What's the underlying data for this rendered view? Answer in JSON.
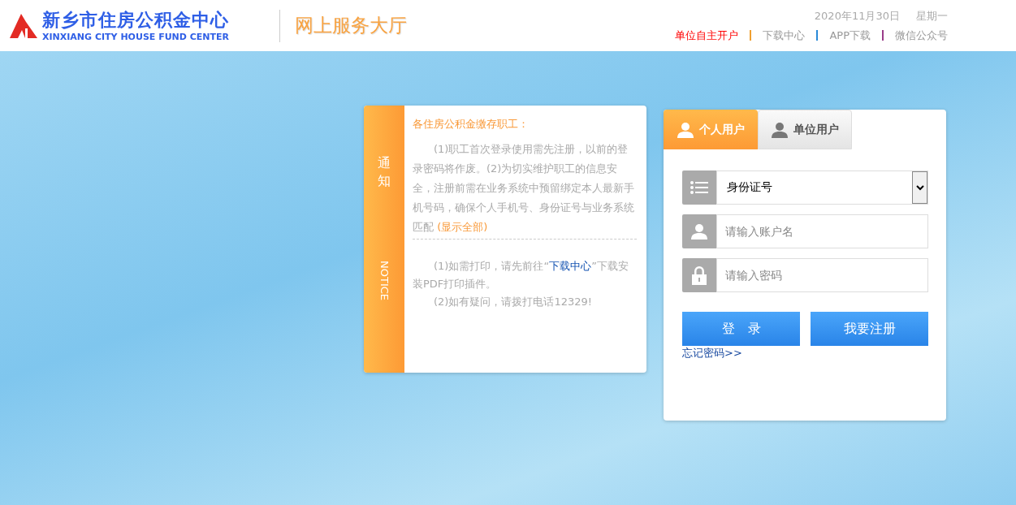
{
  "header": {
    "logo_title": "新乡市住房公积金中心",
    "logo_subtitle": "XINXIANG CITY HOUSE FUND CENTER",
    "portal_title": "网上服务大厅",
    "date": "2020年11月30日",
    "weekday": "星期一",
    "nav": [
      {
        "label": "单位自主开户",
        "selected": true
      },
      {
        "label": "下载中心",
        "selected": false
      },
      {
        "label": "APP下载",
        "selected": false
      },
      {
        "label": "微信公众号",
        "selected": false
      }
    ]
  },
  "notice": {
    "side_label": "通知",
    "side_label_en": "NOTICE",
    "heading": "各住房公积金缴存职工：",
    "paragraph_1": {
      "text": "(1)职工首次登录使用需先注册，以前的登录密码将作废。(2)为切实维护职工的信息安全，注册前需在业务系统中预留绑定本人最新手机号码，确保个人手机号、身份证号与业务系统匹配",
      "link": "(显示全部)"
    },
    "paragraph_2": {
      "before": "(1)如需打印，请先前往“",
      "link": "下载中心",
      "after": "”下载安装PDF打印插件。"
    },
    "paragraph_3": "(2)如有疑问，请拨打电话12329!"
  },
  "login": {
    "tabs": [
      {
        "label": "个人用户",
        "selected": true
      },
      {
        "label": "单位用户",
        "selected": false
      }
    ],
    "id_type": "身份证号",
    "username_placeholder": "请输入账户名",
    "password_placeholder": "请输入密码",
    "login_button": "登　录",
    "register_button": "我要注册",
    "forgot_link": "忘记密码>>"
  }
}
